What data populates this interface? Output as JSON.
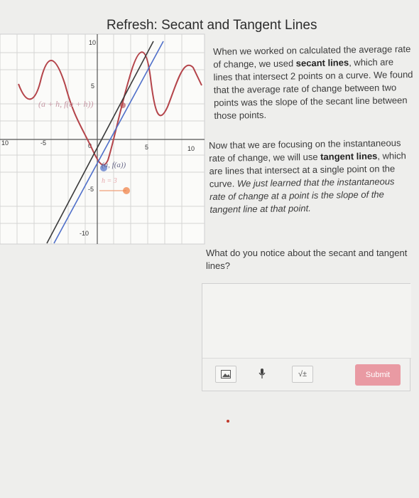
{
  "page_title": "Refresh: Secant and Tangent Lines",
  "graph": {
    "x_ticks": [
      "10",
      "-5",
      "0",
      "5",
      "10"
    ],
    "y_ticks": [
      "10",
      "5",
      "-5",
      "-10"
    ],
    "secant_point_label": "(a + h, f(a + h))",
    "tangent_point_label": "(a, f(a))",
    "h_label": "h = 3",
    "colors": {
      "curve": "#b4444a",
      "secant": "#3a3a3a",
      "tangent": "#4f6fc9",
      "slider": "#f0844a"
    }
  },
  "paragraph1": {
    "t1": "When we worked on calculated the average rate of change, we used ",
    "bold": "secant lines",
    "t2": ", which are lines that intersect 2 points on a curve. We found that the average rate of change between two points was the slope of the secant line between those points."
  },
  "paragraph2": {
    "t1": "Now that we are focusing on the instantaneous rate of change, we will use ",
    "bold": "tangent lines",
    "t2": ", which are lines that intersect at a single point on the curve. ",
    "italic": "We just learned that the instantaneous rate of change at a point is the slope of the tangent line at that point."
  },
  "question": "What do you notice about the secant and tangent lines?",
  "toolbar": {
    "image_icon": "image-icon",
    "mic_icon": "microphone-icon",
    "math_icon": "math-equation-icon",
    "math_label": "√±",
    "submit_label": "Submit"
  }
}
